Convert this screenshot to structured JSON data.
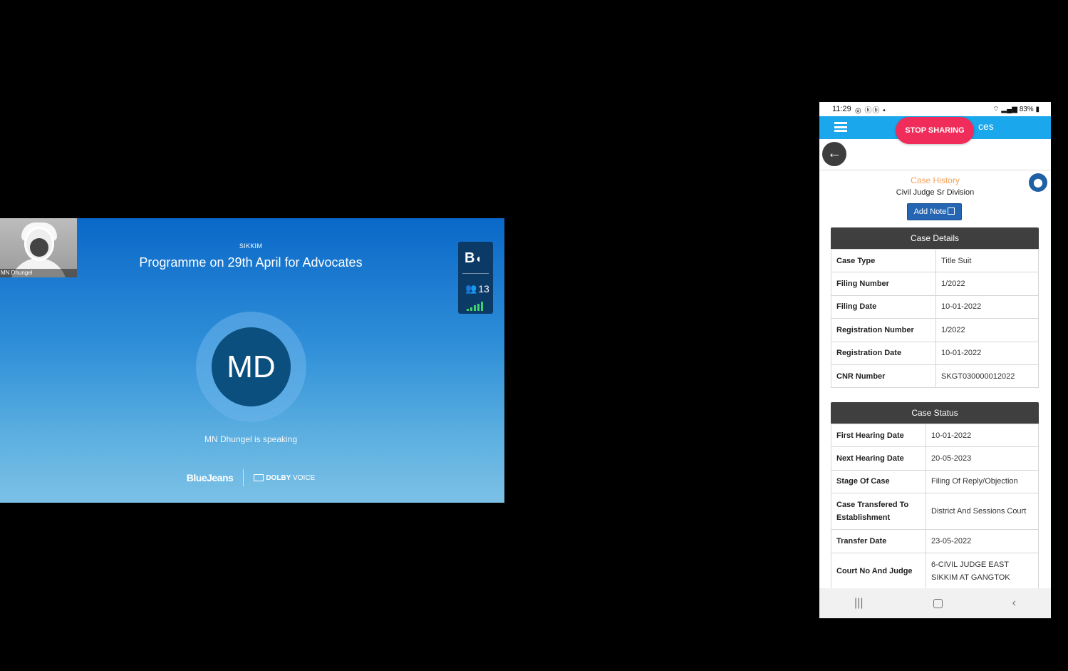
{
  "meeting": {
    "self_view_name": "MN Dhungel",
    "region": "SIKKIM",
    "title": "Programme on 29th April for Advocates",
    "avatar_initials": "MD",
    "speaking_text": "MN Dhungel is speaking",
    "brand": "BlueJeans",
    "partner_bold": "DOLBY",
    "partner_thin": "VOICE",
    "side_logo": "B",
    "participant_count": "13",
    "signal_bars": 5,
    "accent_color": "#0a68c8",
    "signal_color": "#3fd16b"
  },
  "phone": {
    "status_bar": {
      "time": "11:29",
      "left_icons": "◎ ⓗⓑ •",
      "battery": "83%"
    },
    "app_bar": {
      "title_fragment": "ces",
      "color": "#1aa7ec"
    },
    "stop_sharing_label": "STOP SHARING",
    "page_heading": "Case History",
    "court": "Civil Judge Sr Division",
    "add_note_label": "Add Note",
    "case_details": {
      "heading": "Case Details",
      "rows": [
        {
          "label": "Case Type",
          "value": "Title Suit"
        },
        {
          "label": "Filing Number",
          "value": "1/2022"
        },
        {
          "label": "Filing Date",
          "value": "10-01-2022"
        },
        {
          "label": "Registration Number",
          "value": "1/2022"
        },
        {
          "label": "Registration Date",
          "value": "10-01-2022"
        },
        {
          "label": "CNR Number",
          "value": "SKGT030000012022"
        }
      ]
    },
    "case_status": {
      "heading": "Case Status",
      "rows": [
        {
          "label": "First Hearing Date",
          "value": "10-01-2022"
        },
        {
          "label": "Next Hearing Date",
          "value": "20-05-2023"
        },
        {
          "label": "Stage Of Case",
          "value": "Filing Of Reply/Objection"
        },
        {
          "label": "Case Transfered To Establishment",
          "value": "District And Sessions Court"
        },
        {
          "label": "Transfer Date",
          "value": "23-05-2022"
        },
        {
          "label": "Court No And Judge",
          "value": "6-CIVIL JUDGE EAST SIKKIM AT GANGTOK"
        }
      ]
    },
    "nav": {
      "recents_glyph": "|||",
      "back_glyph": "‹"
    }
  }
}
